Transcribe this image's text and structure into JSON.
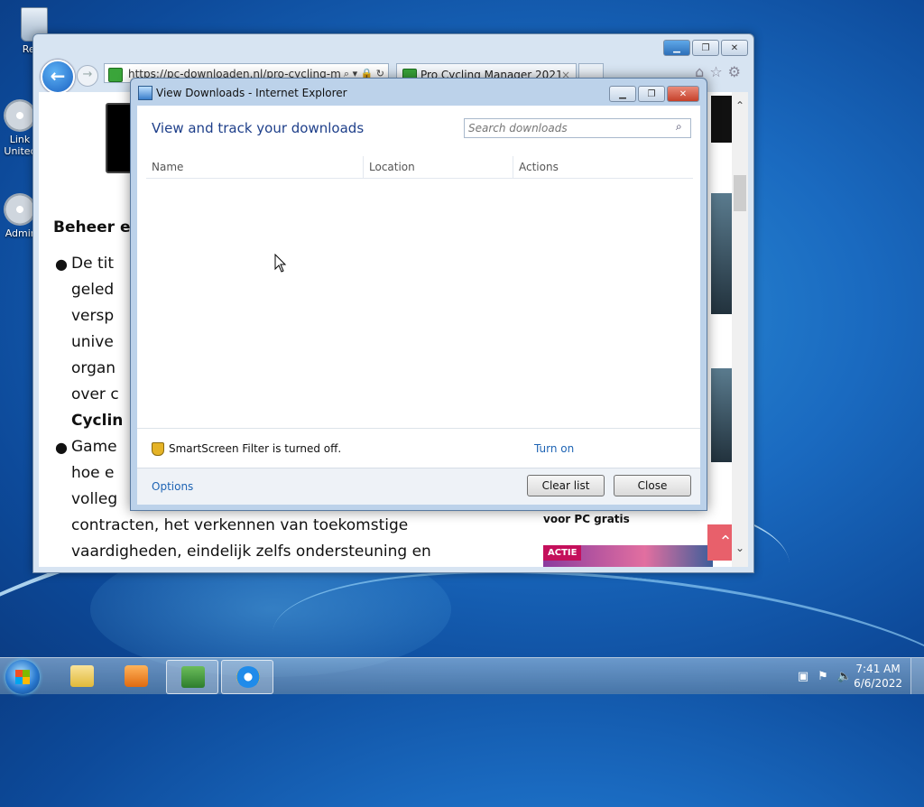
{
  "desktop": {
    "icons": [
      {
        "label": "Recy"
      },
      {
        "label": "Link\nUnitec"
      },
      {
        "label": "Admir"
      }
    ]
  },
  "browser": {
    "address": "https://pc-downloaden.nl/pro-cycling-m",
    "tab_title": "Pro Cycling Manager 2021",
    "tab_close": "×",
    "page": {
      "heading": "Beheer en",
      "bullet1_lines": [
        "De tit",
        "geled",
        "versp",
        "unive",
        "organ",
        "over c"
      ],
      "bullet1_bold": "Cyclin",
      "bullet2_lines": [
        "Game",
        "hoe e",
        "volleg",
        "contracten, het verkennen van toekomstige",
        "vaardigheden, eindelijk zelfs ondersteuning en"
      ],
      "side_caption": "voor PC gratis",
      "actie_label": "ACTIE"
    }
  },
  "dialog": {
    "title": "View Downloads - Internet Explorer",
    "heading": "View and track your downloads",
    "search_placeholder": "Search downloads",
    "columns": [
      "Name",
      "Location",
      "Actions"
    ],
    "smartscreen_text": "SmartScreen Filter is turned off.",
    "turn_on": "Turn on",
    "options": "Options",
    "clear_list": "Clear list",
    "close": "Close"
  },
  "taskbar": {
    "time": "7:41 AM",
    "date": "6/6/2022"
  }
}
